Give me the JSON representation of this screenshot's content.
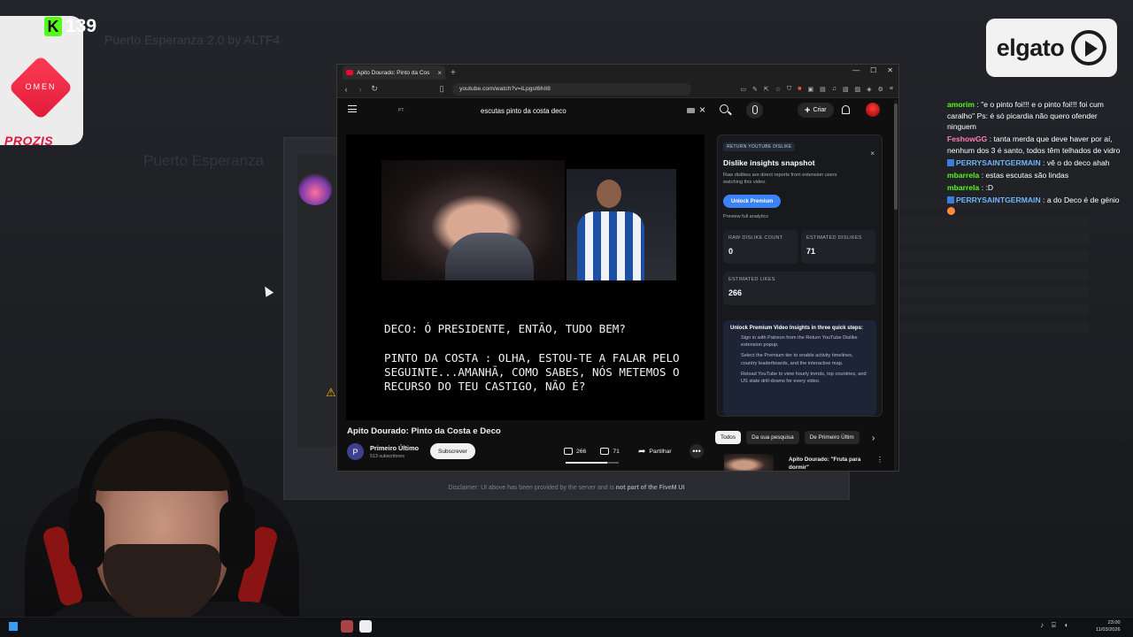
{
  "background": {
    "title": "Puerto Esperanza 2.0 by ALTF4",
    "panel_title": "Puerto Esperanza",
    "disclaimer_prefix": "Disclaimer: UI above has been provided by the server and is ",
    "disclaimer_bold": "not part of the FiveM UI"
  },
  "overlay": {
    "kick_count": "139",
    "sponsor_omen": "OMEN",
    "sponsor_prozis": "PROZIS",
    "elgato": "elgato"
  },
  "chat": [
    {
      "user": "amorim",
      "color": "#53fc18",
      "badge": false,
      "text": "\"e o pinto foi!!! e o pinto foi!!! foi cum caralho\" Ps: é só picardia não quero ofender ninguem"
    },
    {
      "user": "FeshowGG",
      "color": "#ff7fb0",
      "badge": false,
      "text": "tanta merda que deve haver por aí, nenhum dos 3 é santo, todos têm telhados de vidro"
    },
    {
      "user": "PERRYSAINTGERMAIN",
      "color": "#6fb6ff",
      "badge": true,
      "text": "vê o do deco ahah"
    },
    {
      "user": "mbarrela",
      "color": "#53fc18",
      "badge": false,
      "text": "estas escutas são lindas"
    },
    {
      "user": "mbarrela",
      "color": "#53fc18",
      "badge": false,
      "text": ":D"
    },
    {
      "user": "PERRYSAINTGERMAIN",
      "color": "#6fb6ff",
      "badge": true,
      "text": "a do Deco é de génio"
    }
  ],
  "browser": {
    "tab_title": "Apito Dourado: Pinto da Cos",
    "url": "youtube.com/watch?v=iLpgst6hII8",
    "win_min": "—",
    "win_max": "☐",
    "win_close": "✕"
  },
  "youtube": {
    "locale": "PT",
    "search_query": "escutas pinto da costa deco",
    "create_label": "Criar",
    "subtitle_1": "DECO: Ó PRESIDENTE, ENTÃO, TUDO BEM?",
    "subtitle_2": "PINTO DA COSTA : OLHA, ESTOU-TE A FALAR PELO SEGUINTE...AMANHÃ, COMO SABES, NÓS METEMOS O RECURSO DO TEU CASTIGO, NÃO É?",
    "video_title": "Apito Dourado: Pinto da Costa e Deco",
    "channel_initial": "P",
    "channel_name": "Primeiro Último",
    "channel_subs": "513 subscritores",
    "subscribe_label": "Subscrever",
    "likes": "266",
    "dislikes": "71",
    "like_ratio": 0.79,
    "share_label": "Partilhar",
    "more_label": "•••",
    "chips": [
      "Todos",
      "Da sua pesquisa",
      "De Primeiro Últim"
    ],
    "rec_title": "Apito Dourado: \"Fruta para dormir\""
  },
  "dislike_panel": {
    "tag": "RETURN YOUTUBE DISLIKE",
    "close": "×",
    "title": "Dislike insights snapshot",
    "desc": "Raw dislikes are direct reports from extension users watching this video.",
    "unlock_label": "Unlock Premium",
    "preview_link": "Preview full analytics",
    "raw_label": "RAW DISLIKE COUNT",
    "raw_value": "0",
    "est_dislikes_label": "ESTIMATED DISLIKES",
    "est_dislikes_value": "71",
    "est_likes_label": "ESTIMATED LIKES",
    "est_likes_value": "266",
    "steps_title": "Unlock Premium Video Insights in three quick steps:",
    "steps": [
      "Sign in with Patreon from the Return YouTube Dislike extension popup.",
      "Select the Premium tier to enable activity timelines, country leaderboards, and the interactive map.",
      "Reload YouTube to view hourly trends, top countries, and US state drill-downs for every video."
    ]
  },
  "taskbar": {
    "time": "23:00",
    "date": "11/03/2026"
  }
}
